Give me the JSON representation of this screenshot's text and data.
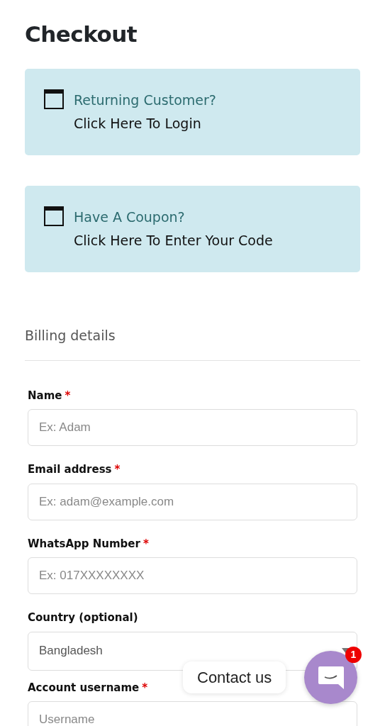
{
  "page": {
    "title": "Checkout"
  },
  "notices": [
    {
      "heading": "Returning Customer?",
      "link": "Click Here To Login"
    },
    {
      "heading": "Have A Coupon?",
      "link": "Click Here To Enter Your Code"
    }
  ],
  "billing": {
    "heading": "Billing details",
    "fields": [
      {
        "kind": "input",
        "label": "Name",
        "required_mark": "*",
        "placeholder": "Ex: Adam"
      },
      {
        "kind": "input",
        "label": "Email address",
        "required_mark": "*",
        "placeholder": "Ex: adam@example.com"
      },
      {
        "kind": "input",
        "label": "WhatsApp Number",
        "required_mark": "*",
        "placeholder": "Ex: 017XXXXXXXX"
      },
      {
        "kind": "select",
        "label": "Country (optional)",
        "value": "Bangladesh"
      },
      {
        "kind": "input",
        "label": "Account username",
        "required_mark": "*",
        "placeholder": "Username"
      }
    ]
  },
  "chat": {
    "label": "Contact us",
    "badge": "1"
  }
}
